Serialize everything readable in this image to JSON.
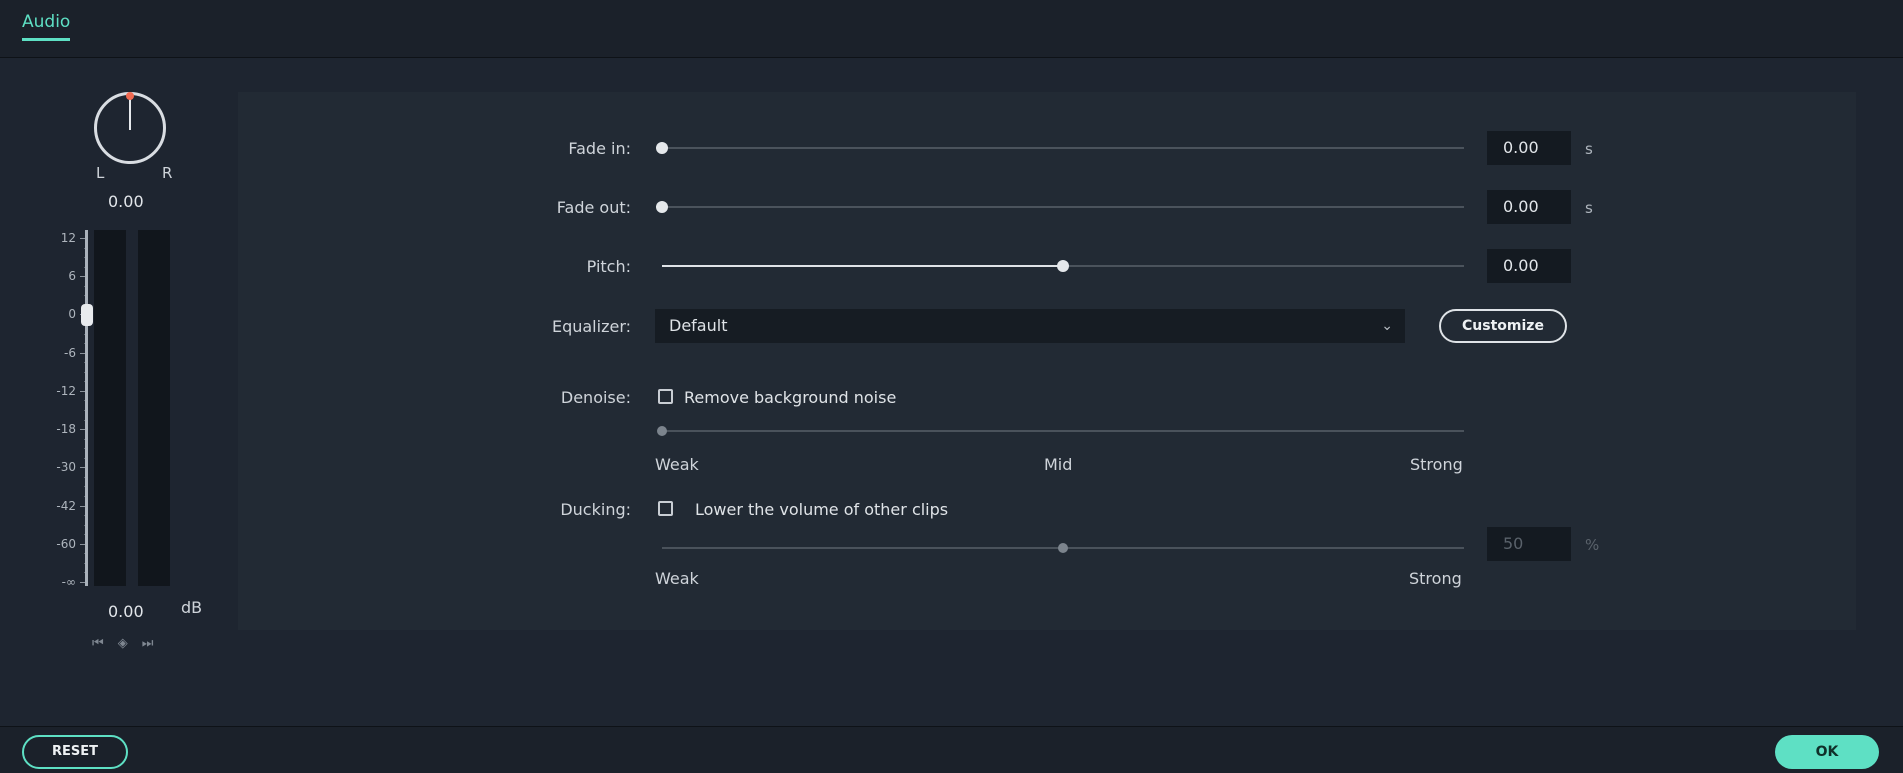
{
  "tabs": {
    "audio": "Audio"
  },
  "volume_panel": {
    "pan": {
      "left_label": "L",
      "right_label": "R",
      "value": "0.00"
    },
    "scale_ticks": [
      "12",
      "6",
      "0",
      "-6",
      "-12",
      "-18",
      "-30",
      "-42",
      "-60",
      "-∞"
    ],
    "volume_value": "0.00",
    "unit": "dB",
    "keyframe_icons": [
      "prev-keyframe-icon",
      "add-keyframe-icon",
      "next-keyframe-icon"
    ]
  },
  "settings": {
    "fade_in": {
      "label": "Fade in:",
      "value": "0.00",
      "unit": "s",
      "level": 0
    },
    "fade_out": {
      "label": "Fade out:",
      "value": "0.00",
      "unit": "s",
      "level": 0
    },
    "pitch": {
      "label": "Pitch:",
      "value": "0.00",
      "level": 0.5
    },
    "equalizer": {
      "label": "Equalizer:",
      "selected": "Default",
      "customize_label": "Customize"
    },
    "denoise": {
      "label": "Denoise:",
      "checkbox_label": "Remove background noise",
      "checked": false,
      "level": 0,
      "scale": {
        "weak": "Weak",
        "mid": "Mid",
        "strong": "Strong"
      }
    },
    "ducking": {
      "label": "Ducking:",
      "checkbox_label": "Lower the volume of other clips",
      "checked": false,
      "level": 0.5,
      "value": "50",
      "unit": "%",
      "scale": {
        "weak": "Weak",
        "strong": "Strong"
      }
    }
  },
  "footer": {
    "reset_label": "RESET",
    "ok_label": "OK"
  },
  "colors": {
    "accent": "#5ee0c4",
    "pan_indicator": "#f06a52"
  }
}
